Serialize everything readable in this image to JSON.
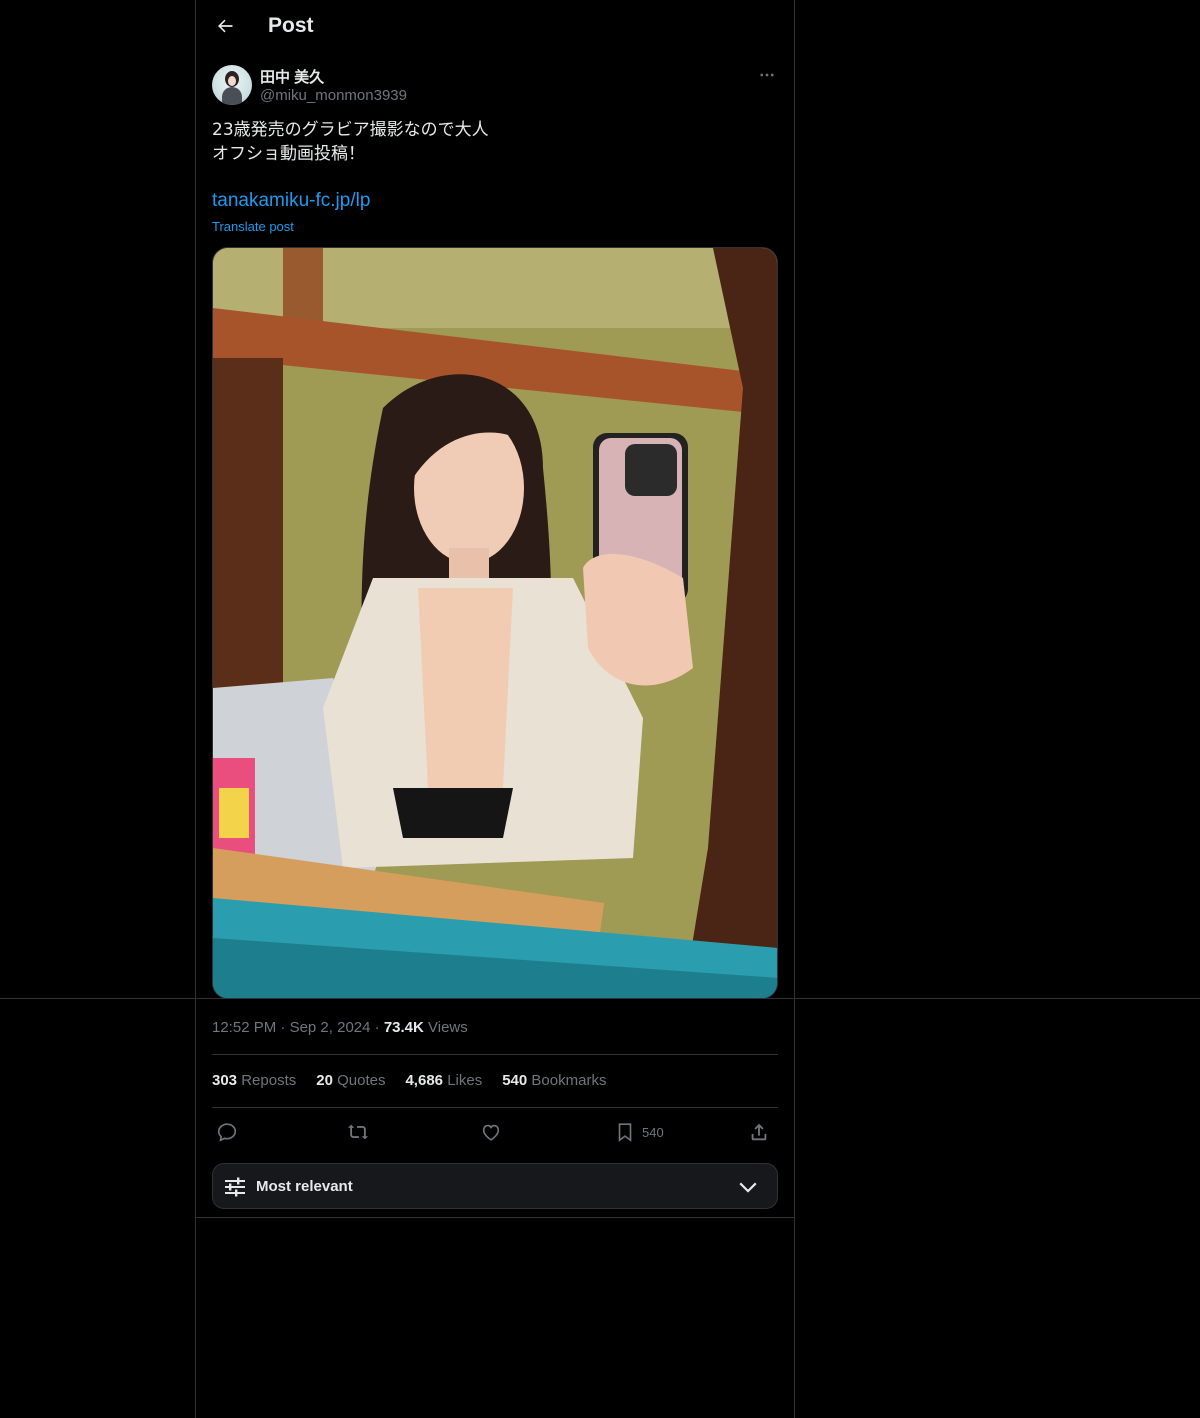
{
  "header": {
    "title": "Post",
    "back_icon": "arrow-left-icon"
  },
  "author": {
    "display_name": "田中 美久",
    "handle": "@miku_monmon3939",
    "more_icon": "more-dots-icon"
  },
  "post": {
    "text_line1": "23歳発売のグラビア撮影なので大人",
    "text_line2": "オフショ動画投稿！",
    "link": "tanakamiku-fc.jp/lp",
    "translate_label": "Translate post",
    "time": "12:52 PM",
    "date": "Sep 2, 2024",
    "views_count": "73.4K",
    "views_label": "Views"
  },
  "stats": {
    "reposts_count": "303",
    "reposts_label": "Reposts",
    "quotes_count": "20",
    "quotes_label": "Quotes",
    "likes_count": "4,686",
    "likes_label": "Likes",
    "bookmarks_count": "540",
    "bookmarks_label": "Bookmarks"
  },
  "actions": {
    "reply_icon": "reply-icon",
    "repost_icon": "repost-icon",
    "like_icon": "heart-icon",
    "bookmark_icon": "bookmark-icon",
    "bookmark_count": "540",
    "share_icon": "share-icon"
  },
  "replies_sort": {
    "label": "Most relevant",
    "icon": "sliders-icon",
    "dropdown_icon": "chevron-down-icon"
  },
  "colors": {
    "background": "#000000",
    "text": "#e7e9ea",
    "muted": "#71767b",
    "link": "#1d9bf0",
    "border": "#2f3336"
  }
}
